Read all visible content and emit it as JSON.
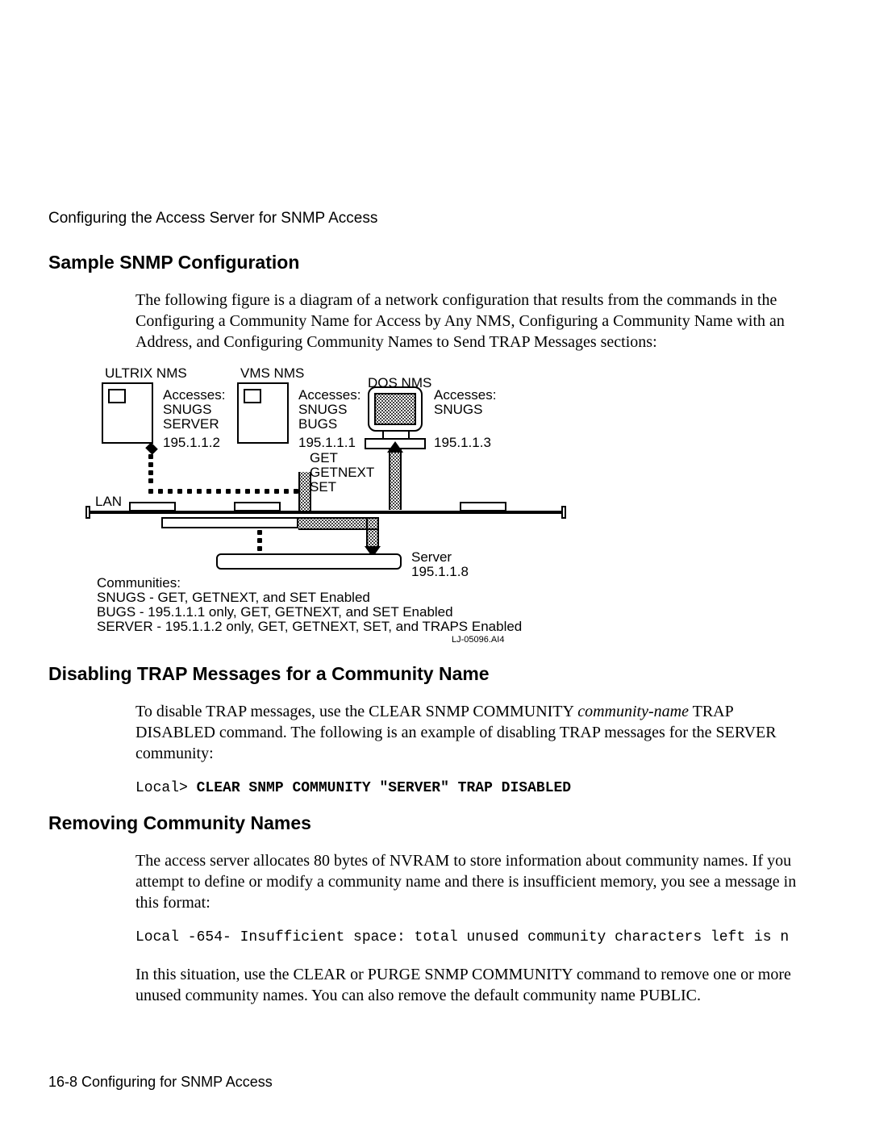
{
  "runningHead": "Configuring the Access Server for SNMP Access",
  "sec1": {
    "title": "Sample SNMP Configuration",
    "p1": "The following figure is a diagram of a network configuration that results from the commands in the Configuring a Community Name for Access by Any NMS, Configuring a Community Name with an Address, and Configuring Community Names to Send TRAP Messages sections:"
  },
  "diagram": {
    "ultrix": "ULTRIX NMS",
    "vms": "VMS NMS",
    "dos": "DOS NMS",
    "lan": "LAN",
    "accesses": "Accesses:",
    "col1l2": "SNUGS",
    "col1l3": "SERVER",
    "col1ip": "195.1.1.2",
    "col2l2": "SNUGS",
    "col2l3": "BUGS",
    "col2ip": "195.1.1.1",
    "col3l2": "SNUGS",
    "col3ip": "195.1.1.3",
    "op1": "GET",
    "op2": "GETNEXT",
    "op3": "SET",
    "server": "Server",
    "serverip": "195.1.1.8",
    "commHead": "Communities:",
    "comm1": "SNUGS - GET, GETNEXT, and SET Enabled",
    "comm2": "BUGS - 195.1.1.1 only, GET, GETNEXT, and SET Enabled",
    "comm3": "SERVER - 195.1.1.2 only, GET, GETNEXT, SET, and TRAPS Enabled",
    "figref": "LJ-05096.AI4"
  },
  "sec2": {
    "title": "Disabling TRAP Messages for a Community Name",
    "p1a": "To disable TRAP messages, use the CLEAR SNMP COMMUNITY ",
    "p1i": "community-name",
    "p1b": " TRAP DISABLED command. The following is an example of disabling TRAP messages for the SERVER community:",
    "codePrompt": "Local> ",
    "codeCmd": "CLEAR SNMP COMMUNITY \"SERVER\" TRAP DISABLED"
  },
  "sec3": {
    "title": "Removing Community Names",
    "p1": "The access server allocates 80 bytes of NVRAM to store information about community names. If you attempt to define or modify a community name and there is insufficient memory, you see a message in this format:",
    "code": "Local -654- Insufficient space: total unused community characters left is n",
    "p2": "In this situation, use the CLEAR or PURGE SNMP COMMUNITY command to remove one or more unused community names. You can also remove the default community name PUBLIC."
  },
  "footer": "16-8  Configuring for SNMP Access"
}
